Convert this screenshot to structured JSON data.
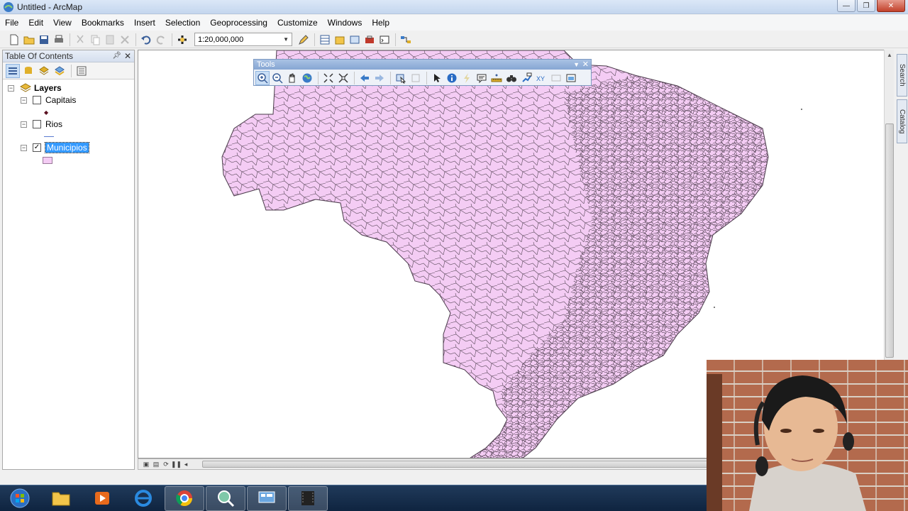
{
  "window": {
    "title": "Untitled - ArcMap"
  },
  "menu": [
    "File",
    "Edit",
    "View",
    "Bookmarks",
    "Insert",
    "Selection",
    "Geoprocessing",
    "Customize",
    "Windows",
    "Help"
  ],
  "toolbar": {
    "scale": "1:20,000,000"
  },
  "toc": {
    "title": "Table Of Contents",
    "root": "Layers",
    "layers": [
      {
        "name": "Capitais",
        "checked": false
      },
      {
        "name": "Rios",
        "checked": false
      },
      {
        "name": "Municipios",
        "checked": true
      }
    ]
  },
  "tools_toolbar": {
    "title": "Tools"
  },
  "side_tabs": [
    "Search",
    "Catalog"
  ],
  "colors": {
    "polygon_fill": "#f4ccf4",
    "polygon_stroke": "#4a3a4a",
    "selection": "#3399ff"
  }
}
